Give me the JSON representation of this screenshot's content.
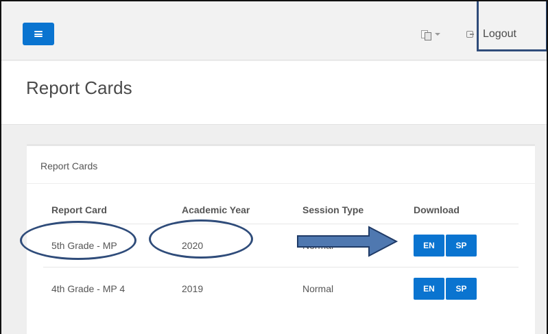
{
  "header": {
    "logout_label": "Logout",
    "menu_icon": "hamburger-menu-icon",
    "language_icon": "translate-icon",
    "logout_icon": "logout-icon"
  },
  "page": {
    "title": "Report Cards"
  },
  "panel": {
    "title": "Report Cards",
    "columns": [
      "Report Card",
      "Academic Year",
      "Session Type",
      "Download"
    ],
    "rows": [
      {
        "report_card": "5th Grade - MP",
        "academic_year": "2020",
        "session_type": "Normal",
        "en": "EN",
        "sp": "SP"
      },
      {
        "report_card": "4th Grade - MP 4",
        "academic_year": "2019",
        "session_type": "Normal",
        "en": "EN",
        "sp": "SP"
      }
    ]
  },
  "colors": {
    "primary": "#0a74d0",
    "annotation": "#2f4c7a",
    "arrow_fill": "#4f78b0"
  }
}
